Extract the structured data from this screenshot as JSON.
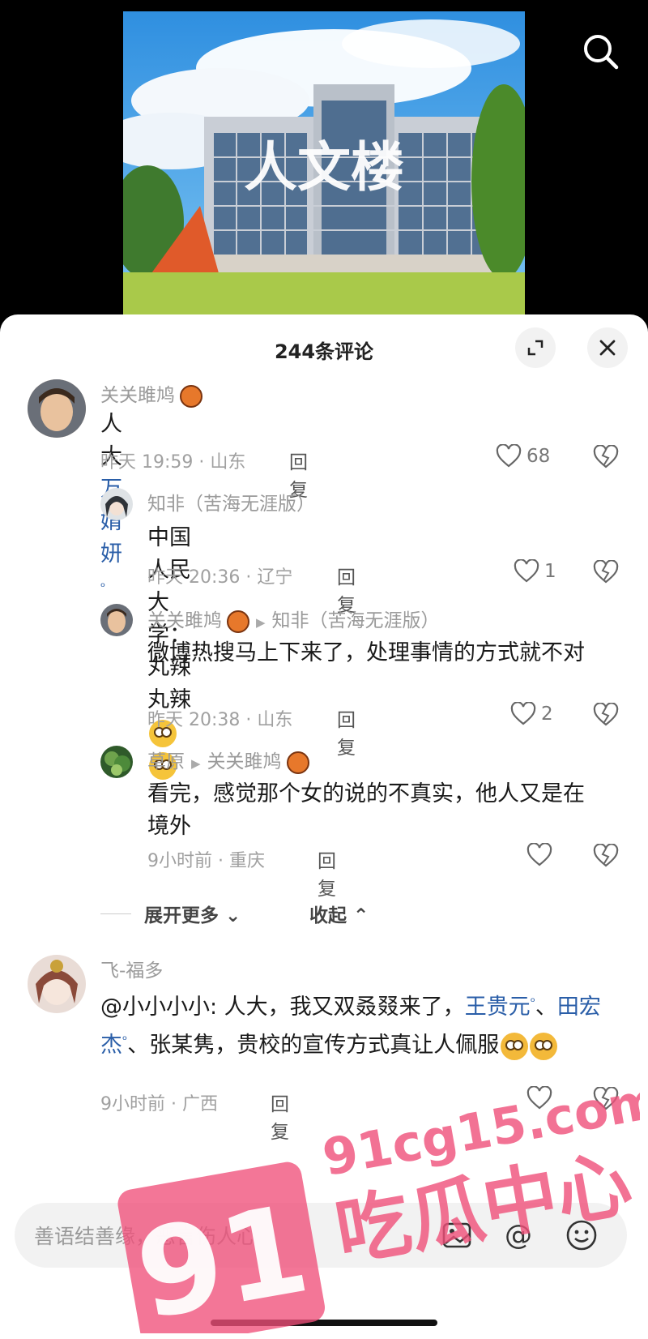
{
  "video": {
    "cover_text": "人文楼"
  },
  "sheet": {
    "title": "244条评论"
  },
  "comments": [
    {
      "name": "关关雎鸠",
      "text_prefix": "人大",
      "mention": "万婧妍",
      "time": "昨天 19:59 · 山东",
      "reply": "回复",
      "likes": "68"
    },
    {
      "name": "知非（苦海无涯版）",
      "text": "中国人民大学：丸辣丸辣",
      "time": "昨天 20:36 · 辽宁",
      "reply": "回复",
      "likes": "1"
    },
    {
      "name": "关关雎鸠",
      "reply_to": "知非（苦海无涯版）",
      "text": "微博热搜马上下来了，处理事情的方式就不对",
      "time": "昨天 20:38 · 山东",
      "reply": "回复",
      "likes": "2"
    },
    {
      "name": "草原",
      "reply_to": "关关雎鸠",
      "text": "看完，感觉那个女的说的不真实，他人又是在境外",
      "time": "9小时前 · 重庆",
      "reply": "回复",
      "likes": ""
    },
    {
      "name": "飞-福多",
      "text_a": "@小小小小: 人大，我又双叒叕来了，",
      "mention_a": "王贵元",
      "sep": "、",
      "mention_b": "田宏杰",
      "text_b": "、张某隽，贵校的宣传方式真让人佩服",
      "time": "9小时前 · 广西",
      "reply": "回复"
    }
  ],
  "expand": {
    "more": "展开更多",
    "collapse": "收起"
  },
  "input": {
    "placeholder": "善语结善缘，恶言伤人心"
  },
  "watermark": {
    "number": "91",
    "site": "91cg15.com",
    "slogan": "吃瓜中心"
  },
  "colors": {
    "mention": "#2a5ea8",
    "watermark": "#f0507a"
  }
}
